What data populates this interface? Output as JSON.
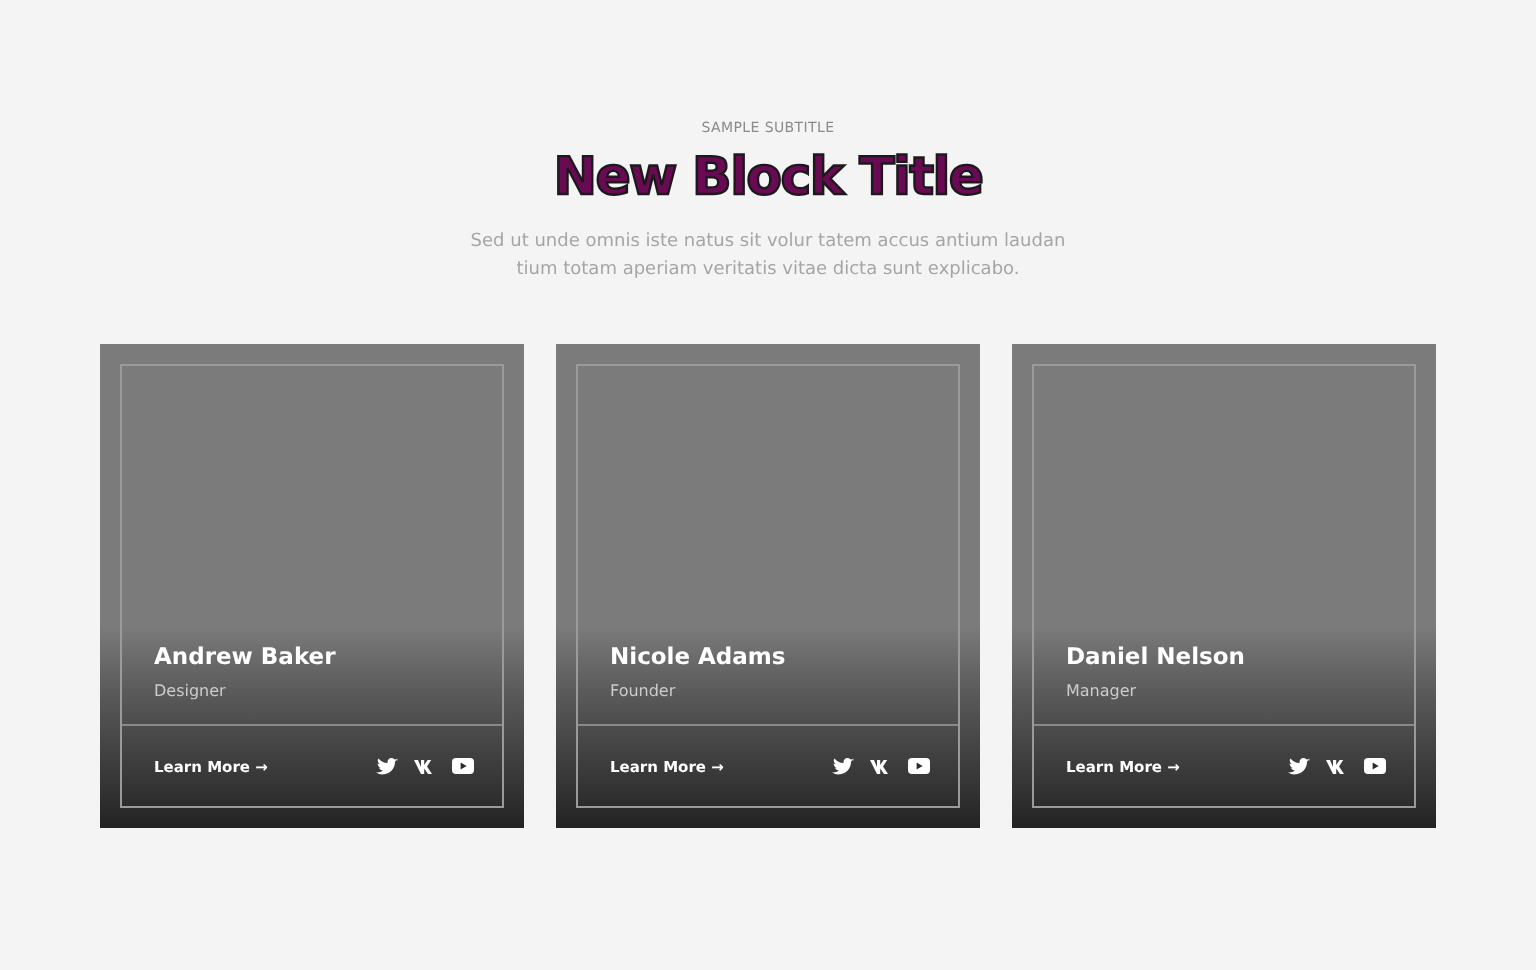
{
  "header": {
    "subtitle": "SAMPLE SUBTITLE",
    "title": "New Block Title",
    "description": "Sed ut unde omnis iste natus sit volur tatem accus antium laudan tium totam aperiam veritatis vitae dicta sunt explicabo."
  },
  "members": [
    {
      "name": "Andrew Baker",
      "role": "Designer",
      "link": "Learn More →"
    },
    {
      "name": "Nicole Adams",
      "role": "Founder",
      "link": "Learn More →"
    },
    {
      "name": "Daniel Nelson",
      "role": "Manager",
      "link": "Learn More →"
    }
  ]
}
